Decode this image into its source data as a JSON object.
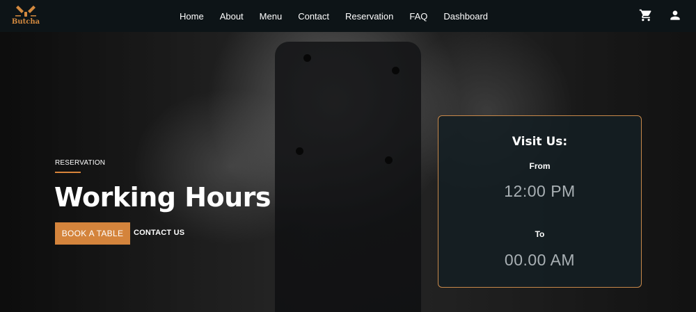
{
  "brand": {
    "name": "Butcha",
    "color": "#d48a3f"
  },
  "nav": {
    "links": [
      "Home",
      "About",
      "Menu",
      "Contact",
      "Reservation",
      "FAQ",
      "Dashboard"
    ],
    "icons": [
      "cart-icon",
      "user-icon"
    ]
  },
  "hero": {
    "eyebrow": "RESERVATION",
    "title": "Working Hours",
    "book_button": "BOOK A TABLE",
    "contact_button": "CONTACT US",
    "accent_color": "#d4843c"
  },
  "visit_card": {
    "title": "Visit Us:",
    "from_label": "From",
    "from_time": "12:00 PM",
    "to_label": "To",
    "to_time": "00.00 AM"
  }
}
